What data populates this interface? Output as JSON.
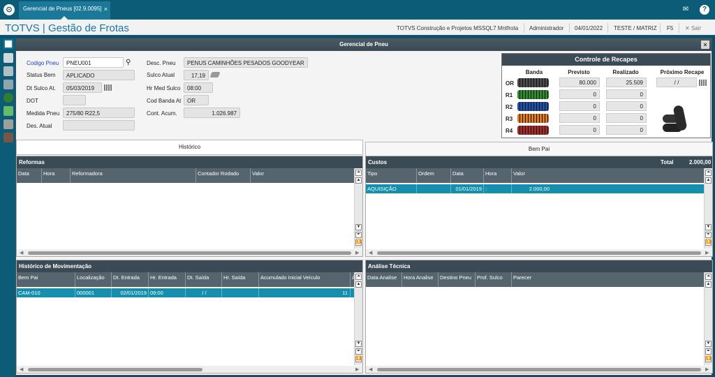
{
  "topbar": {
    "tab_title": "Gerencial de Pneus [02.9.0095]",
    "tab_close": "×",
    "logo_glyph": "⊙",
    "mail_glyph": "✉",
    "help_glyph": "?"
  },
  "header": {
    "app_title": "TOTVS | Gestão de Frotas",
    "company": "TOTVS Construção e Projetos MSSQL7 Mntfrota",
    "user": "Administrador",
    "date": "04/01/2022",
    "environment": "TESTE / MATRIZ",
    "shortcut": "F5",
    "exit_label": "Sair",
    "exit_glyph": "✕"
  },
  "window": {
    "title": "Gerencial de Pneu",
    "close_glyph": "×"
  },
  "form": {
    "codigo_pneu_label": "Codigo Pneu",
    "codigo_pneu": "PNEU001",
    "status_bem_label": "Status Bem",
    "status_bem": "APLICADO",
    "dt_sulco_label": "Dt Sulco At.",
    "dt_sulco": "05/03/2019",
    "dot_label": "DOT",
    "dot": "",
    "medida_pneu_label": "Medida Pneu",
    "medida_pneu": "275/80 R22,5",
    "des_atual_label": "Des. Atual",
    "des_atual": "",
    "desc_pneu_label": "Desc. Pneu",
    "desc_pneu": "PENUS CAMINHÕES PESADOS GOODYEAR",
    "sulco_atual_label": "Sulco Atual",
    "sulco_atual": "17,19",
    "hr_med_sulco_label": "Hr Med Sulco",
    "hr_med_sulco": "08:00",
    "cod_banda_label": "Cod Banda At",
    "cod_banda": "OR",
    "cont_acum_label": "Cont. Acum.",
    "cont_acum": "1.026.987"
  },
  "recapes": {
    "title": "Controle de Recapes",
    "headers": {
      "banda": "Banda",
      "previsto": "Previsto",
      "realizado": "Realizado",
      "proximo": "Próximo Recape"
    },
    "proximo_value": " / /",
    "rows": [
      {
        "label": "OR",
        "previsto": "80.000",
        "realizado": "25.509",
        "color": "#4a4a4a"
      },
      {
        "label": "R1",
        "previsto": "0",
        "realizado": "0",
        "color": "#2e8b2e"
      },
      {
        "label": "R2",
        "previsto": "0",
        "realizado": "0",
        "color": "#1f4fa8"
      },
      {
        "label": "R3",
        "previsto": "0",
        "realizado": "0",
        "color": "#e07b1a"
      },
      {
        "label": "R4",
        "previsto": "0",
        "realizado": "0",
        "color": "#a52a2a"
      }
    ]
  },
  "tabs": {
    "historico": "Histórico",
    "bem_pai": "Bem Pai"
  },
  "reformas": {
    "title": "Reformas",
    "columns": [
      "Data",
      "Hora",
      "Reformadora",
      "Contador Rodado",
      "Valor"
    ]
  },
  "custos": {
    "title": "Custos",
    "total_label": "Total",
    "total_value": "2.000,00",
    "columns": [
      "Tipo",
      "Ordem",
      "Data",
      "Hora",
      "Valor"
    ],
    "rows": [
      {
        "tipo": "AQUISIÇÃO",
        "ordem": "",
        "data": "01/01/2019",
        "hora": ":",
        "valor": "2.000,00"
      }
    ]
  },
  "movimentacao": {
    "title": "Histórico de Movimentação",
    "columns": [
      "Bem Pai",
      "Localização",
      "Dt. Entrada",
      "Hr. Entrada",
      "Dt. Saída",
      "Hr. Saída",
      "Acumulado Inicial Veículo",
      "A"
    ],
    "rows": [
      {
        "bem_pai": "CAM-010",
        "localizacao": "000001",
        "dt_entrada": "02/01/2019",
        "hr_entrada": "09:00",
        "dt_saida": "/ /",
        "hr_saida": "",
        "acumulado": "11"
      }
    ]
  },
  "analise": {
    "title": "Análise Técnica",
    "columns": [
      "Data Analise",
      "Hora Analise",
      "Destino Pneu",
      "Prof. Sulco",
      "Parecer"
    ]
  },
  "colors": {
    "accent": "#0c5c77",
    "row_selected": "#148fae",
    "panel_header": "#3b4b55"
  }
}
